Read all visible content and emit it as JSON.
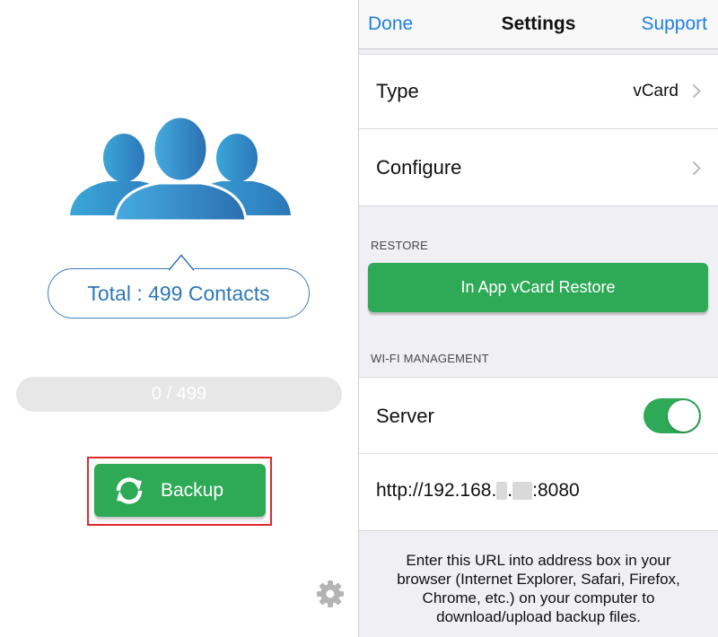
{
  "left_panel": {
    "total_label": "Total : 499 Contacts",
    "progress_text": "0 / 499",
    "progress_fraction": 0,
    "backup_label": "Backup"
  },
  "icons": {
    "contacts": "people-group-icon",
    "sync": "sync-arrows-icon",
    "settings": "gear-icon",
    "disclosure": "chevron-right-icon"
  },
  "settings": {
    "nav": {
      "done": "Done",
      "title": "Settings",
      "support": "Support"
    },
    "type": {
      "label": "Type",
      "value": "vCard"
    },
    "configure": {
      "label": "Configure"
    },
    "restore_header": "RESTORE",
    "restore_button": "In App vCard Restore",
    "wifi_header": "WI-FI MANAGEMENT",
    "server": {
      "label": "Server",
      "enabled": true
    },
    "url": {
      "prefix": "http://192.168.",
      "dot": ".",
      "port_suffix": ":8080"
    },
    "help_text": "Enter this URL into address box in your browser (Internet Explorer, Safari, Firefox, Chrome, etc.) on your computer to download/upload backup files."
  },
  "colors": {
    "accent_green": "#2eaa57",
    "link_blue": "#1f7fe0",
    "contacts_blue": "#2f78b8",
    "highlight_red": "#e0282e"
  }
}
